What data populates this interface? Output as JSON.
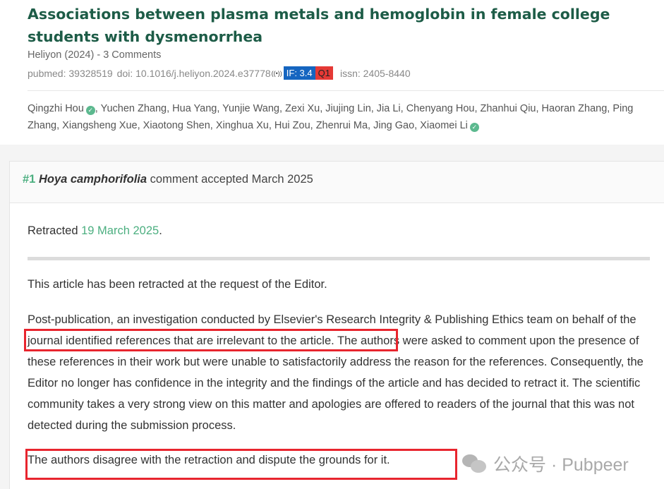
{
  "article": {
    "title": "Associations between plasma metals and hemoglobin in female college students with dysmenorrhea",
    "journal": "Heliyon (2024)",
    "separator": " - ",
    "comments": "3 Comments",
    "pubmed": "pubmed: 39328519",
    "doi": "doi: 10.1016/j.heliyon.2024.e37778",
    "if_badge": "IF: 3.4",
    "quartile": "Q1",
    "issn": "issn: 2405-8440",
    "first_author": "Qingzhi Hou",
    "middle_authors": ", Yuchen Zhang, Hua Yang, Yunjie Wang, Zexi Xu, Jiujing Lin, Jia Li, Chenyang Hou, Zhanhui Qiu, Haoran Zhang, Ping Zhang, Xiangsheng Xue, Xiaotong Shen, Xinghua Xu, Hui Zou, Zhenrui Ma, Jing Gao, ",
    "last_author": "Xiaomei Li"
  },
  "comment": {
    "number": "#1",
    "user": "Hoya camphorifolia",
    "status": "comment accepted March 2025",
    "retracted_label": "Retracted ",
    "retracted_date": "19 March 2025",
    "retracted_period": ".",
    "para1": "This article has been retracted at the request of the Editor.",
    "para2": "Post-publication, an investigation conducted by Elsevier's Research Integrity & Publishing Ethics team on behalf of the journal identified references that are irrelevant to the article. The authors were asked to comment upon the presence of these references in their work but were unable to satisfactorily address the reason for the references. Consequently, the Editor no longer has confidence in the integrity and the findings of the article and has decided to retract it. The scientific community takes a very strong view on this matter and apologies are offered to readers of the journal that this was not detected during the submission process.",
    "para3": "The authors disagree with the retraction and dispute the grounds for it."
  },
  "watermark": {
    "text": "公众号 · Pubpeer",
    "icon": "wechat-icon"
  },
  "colors": {
    "title": "#1d5c47",
    "accent_green": "#4caf80",
    "if_badge": "#1565c0",
    "q1_badge": "#e53935",
    "highlight_box": "#e8252e"
  }
}
